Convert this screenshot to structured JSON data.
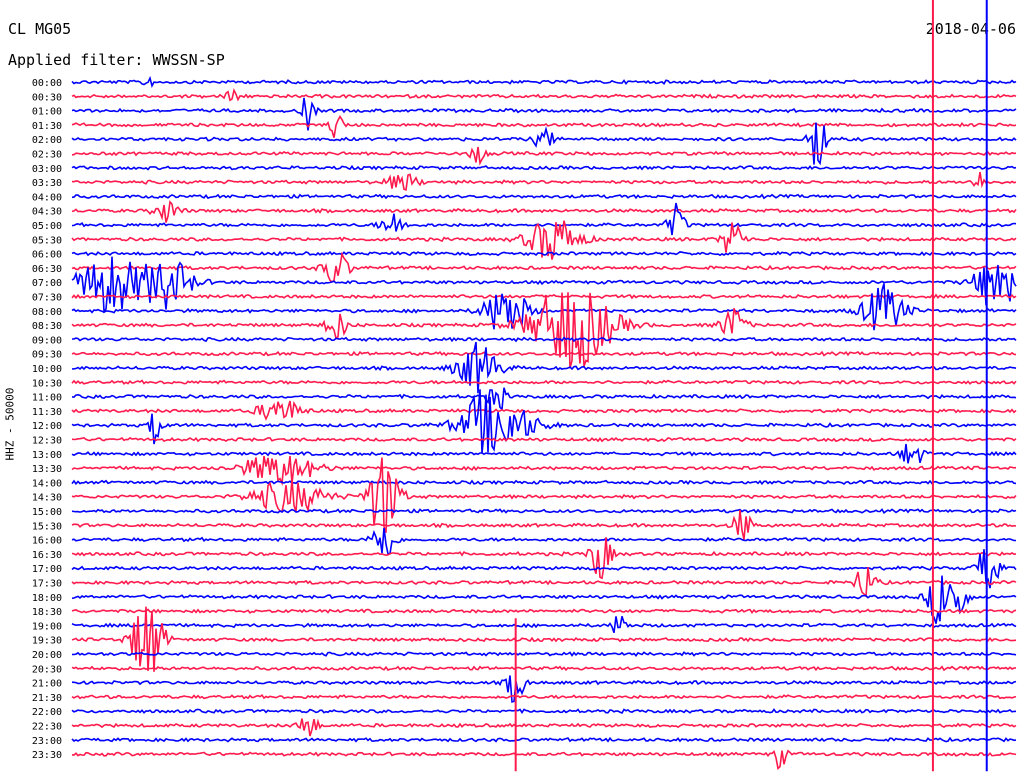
{
  "header": {
    "station": "CL MG05",
    "filter_label": "Applied filter: WWSSN-SP",
    "date": "2018-04-06"
  },
  "colors": {
    "series_a": "#0000ff",
    "series_b": "#ff1a4d"
  },
  "chart_data": {
    "type": "line",
    "title": "",
    "xlabel": "",
    "ylabel": "HHZ - 50000",
    "rows_per_line_minutes": 15,
    "row_count": 48,
    "tick_labels": [
      "00:00",
      "00:30",
      "01:00",
      "01:30",
      "02:00",
      "02:30",
      "03:00",
      "03:30",
      "04:00",
      "04:30",
      "05:00",
      "05:30",
      "06:00",
      "06:30",
      "07:00",
      "07:30",
      "08:00",
      "08:30",
      "09:00",
      "09:30",
      "10:00",
      "10:30",
      "11:00",
      "11:30",
      "12:00",
      "12:30",
      "13:00",
      "13:30",
      "14:00",
      "14:30",
      "15:00",
      "15:30",
      "16:00",
      "16:30",
      "17:00",
      "17:30",
      "18:00",
      "18:30",
      "19:00",
      "19:30",
      "20:00",
      "20:30",
      "21:00",
      "21:30",
      "22:00",
      "22:30",
      "23:00",
      "23:30"
    ],
    "grid": false,
    "legend": "none",
    "events": [
      {
        "row": 0,
        "pos": 0.08,
        "amp": 0.9,
        "width": 0.004
      },
      {
        "row": 1,
        "pos": 0.17,
        "amp": 1.2,
        "width": 0.005
      },
      {
        "row": 2,
        "pos": 0.25,
        "amp": 1.5,
        "width": 0.006
      },
      {
        "row": 3,
        "pos": 0.28,
        "amp": 1.2,
        "width": 0.006
      },
      {
        "row": 4,
        "pos": 0.5,
        "amp": 0.8,
        "width": 0.01
      },
      {
        "row": 4,
        "pos": 0.79,
        "amp": 2.8,
        "width": 0.008
      },
      {
        "row": 5,
        "pos": 0.43,
        "amp": 1.4,
        "width": 0.006
      },
      {
        "row": 7,
        "pos": 0.35,
        "amp": 0.7,
        "width": 0.015
      },
      {
        "row": 7,
        "pos": 0.96,
        "amp": 1.0,
        "width": 0.005
      },
      {
        "row": 9,
        "pos": 0.1,
        "amp": 0.9,
        "width": 0.012
      },
      {
        "row": 10,
        "pos": 0.34,
        "amp": 0.9,
        "width": 0.012
      },
      {
        "row": 10,
        "pos": 0.64,
        "amp": 1.6,
        "width": 0.008
      },
      {
        "row": 11,
        "pos": 0.51,
        "amp": 1.8,
        "width": 0.025
      },
      {
        "row": 11,
        "pos": 0.7,
        "amp": 1.6,
        "width": 0.01
      },
      {
        "row": 13,
        "pos": 0.28,
        "amp": 1.4,
        "width": 0.012
      },
      {
        "row": 14,
        "pos": 0.04,
        "amp": 2.4,
        "width": 0.03
      },
      {
        "row": 14,
        "pos": 0.1,
        "amp": 2.0,
        "width": 0.025
      },
      {
        "row": 14,
        "pos": 0.98,
        "amp": 2.4,
        "width": 0.02
      },
      {
        "row": 16,
        "pos": 0.46,
        "amp": 2.2,
        "width": 0.02
      },
      {
        "row": 16,
        "pos": 0.86,
        "amp": 2.0,
        "width": 0.02
      },
      {
        "row": 17,
        "pos": 0.53,
        "amp": 3.5,
        "width": 0.04
      },
      {
        "row": 17,
        "pos": 0.28,
        "amp": 1.2,
        "width": 0.01
      },
      {
        "row": 17,
        "pos": 0.7,
        "amp": 1.4,
        "width": 0.012
      },
      {
        "row": 20,
        "pos": 0.43,
        "amp": 2.0,
        "width": 0.02
      },
      {
        "row": 22,
        "pos": 0.45,
        "amp": 1.4,
        "width": 0.008
      },
      {
        "row": 23,
        "pos": 0.22,
        "amp": 1.0,
        "width": 0.02
      },
      {
        "row": 24,
        "pos": 0.09,
        "amp": 2.0,
        "width": 0.006
      },
      {
        "row": 24,
        "pos": 0.43,
        "amp": 1.2,
        "width": 0.008
      },
      {
        "row": 24,
        "pos": 0.45,
        "amp": 2.2,
        "width": 0.035
      },
      {
        "row": 26,
        "pos": 0.89,
        "amp": 1.2,
        "width": 0.01
      },
      {
        "row": 27,
        "pos": 0.22,
        "amp": 1.3,
        "width": 0.035
      },
      {
        "row": 29,
        "pos": 0.23,
        "amp": 1.3,
        "width": 0.035
      },
      {
        "row": 29,
        "pos": 0.33,
        "amp": 3.5,
        "width": 0.015
      },
      {
        "row": 31,
        "pos": 0.71,
        "amp": 1.5,
        "width": 0.008
      },
      {
        "row": 32,
        "pos": 0.33,
        "amp": 2.2,
        "width": 0.01
      },
      {
        "row": 33,
        "pos": 0.56,
        "amp": 2.0,
        "width": 0.01
      },
      {
        "row": 34,
        "pos": 0.97,
        "amp": 2.0,
        "width": 0.01
      },
      {
        "row": 35,
        "pos": 0.84,
        "amp": 1.4,
        "width": 0.01
      },
      {
        "row": 36,
        "pos": 0.92,
        "amp": 2.4,
        "width": 0.012
      },
      {
        "row": 36,
        "pos": 0.94,
        "amp": 1.8,
        "width": 0.008
      },
      {
        "row": 38,
        "pos": 0.58,
        "amp": 1.3,
        "width": 0.006
      },
      {
        "row": 39,
        "pos": 0.08,
        "amp": 3.5,
        "width": 0.015
      },
      {
        "row": 42,
        "pos": 0.47,
        "amp": 1.8,
        "width": 0.008
      },
      {
        "row": 45,
        "pos": 0.25,
        "amp": 1.3,
        "width": 0.008
      },
      {
        "row": 47,
        "pos": 0.75,
        "amp": 1.2,
        "width": 0.006
      }
    ],
    "spikes": [
      {
        "pos": 0.912,
        "from_row": 0,
        "to_row": 47
      },
      {
        "pos": 0.969,
        "from_row": 0,
        "to_row": 47
      },
      {
        "pos": 0.47,
        "from_row": 38,
        "to_row": 47
      }
    ]
  }
}
